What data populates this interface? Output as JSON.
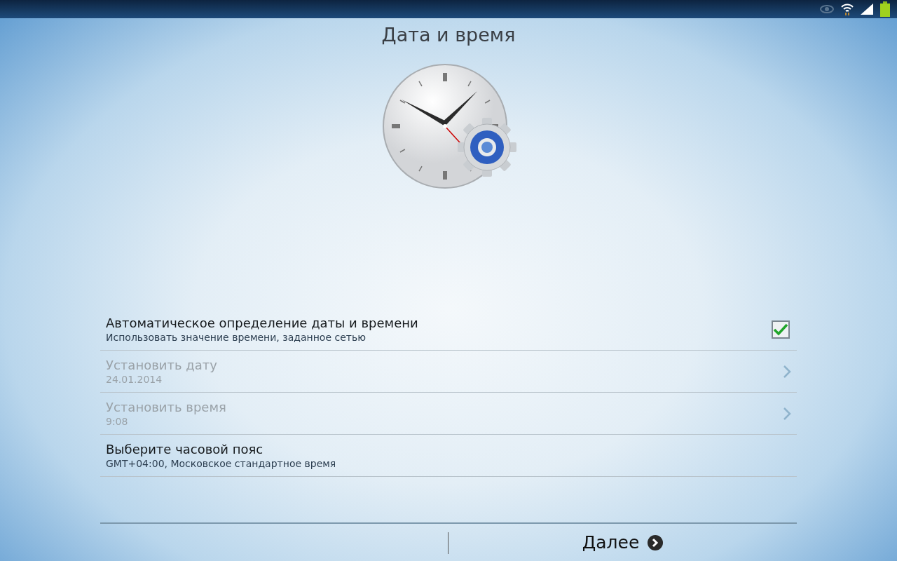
{
  "title": "Дата и время",
  "settings": [
    {
      "kind": "checkbox",
      "title": "Автоматическое определение даты и времени",
      "summary": "Использовать значение времени, заданное сетью",
      "checked": true,
      "disabled": false
    },
    {
      "kind": "link",
      "title": "Установить дату",
      "summary": "24.01.2014",
      "disabled": true
    },
    {
      "kind": "link",
      "title": "Установить время",
      "summary": "9:08",
      "disabled": true
    },
    {
      "kind": "plain",
      "title": "Выберите часовой пояс",
      "summary": "GMT+04:00, Московское стандартное время",
      "disabled": false
    }
  ],
  "footer": {
    "next": "Далее"
  }
}
